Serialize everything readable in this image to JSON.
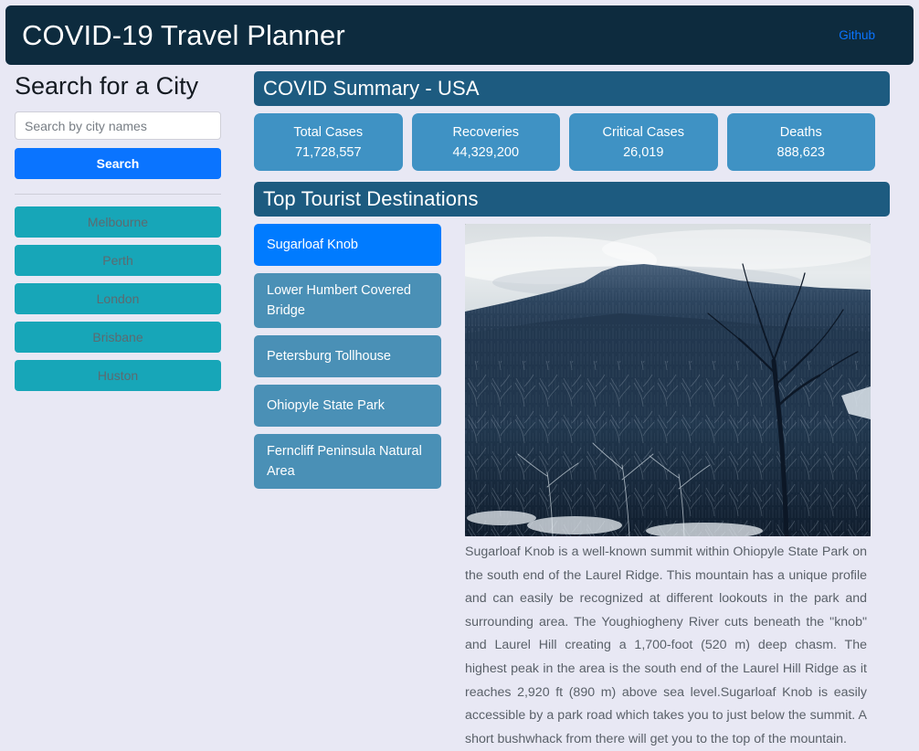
{
  "navbar": {
    "brand": "COVID-19 Travel Planner",
    "link_label": "Github",
    "background_color": "#0d2b3e",
    "link_color": "#0a74ff"
  },
  "sidebar": {
    "title": "Search for a City",
    "search": {
      "placeholder": "Search by city names",
      "value": "",
      "button_label": "Search",
      "button_color": "#0a74ff"
    },
    "cities": [
      {
        "label": "Melbourne"
      },
      {
        "label": "Perth"
      },
      {
        "label": "London"
      },
      {
        "label": "Brisbane"
      },
      {
        "label": "Huston"
      }
    ],
    "city_button_color": "#17a6b8"
  },
  "summary": {
    "header": "COVID Summary - USA",
    "header_color": "#1d5b80",
    "card_color": "#3f92c4",
    "stats": [
      {
        "label": "Total Cases",
        "value": "71,728,557"
      },
      {
        "label": "Recoveries",
        "value": "44,329,200"
      },
      {
        "label": "Critical Cases",
        "value": "26,019"
      },
      {
        "label": "Deaths",
        "value": "888,623"
      }
    ]
  },
  "destinations": {
    "header": "Top Tourist Destinations",
    "header_color": "#1d5b80",
    "item_color": "#4a90b6",
    "active_color": "#007bff",
    "items": [
      {
        "label": "Sugarloaf Knob",
        "active": true
      },
      {
        "label": "Lower Humbert Covered Bridge",
        "active": false
      },
      {
        "label": "Petersburg Tollhouse",
        "active": false
      },
      {
        "label": "Ohiopyle State Park",
        "active": false
      },
      {
        "label": "Ferncliff Peninsula Natural Area",
        "active": false
      }
    ],
    "detail": {
      "photo_alt": "Snow-covered forested ridge with Sugarloaf Knob summit under an overcast winter sky",
      "description": "Sugarloaf Knob is a well-known summit within Ohiopyle State Park on the south end of the Laurel Ridge. This mountain has a unique profile and can easily be recognized at different lookouts in the park and surrounding area. The Youghiogheny River cuts beneath the \"knob\" and Laurel Hill creating a 1,700-foot (520 m) deep chasm. The highest peak in the area is the south end of the Laurel Hill Ridge as it reaches 2,920 ft (890 m) above sea level.Sugarloaf Knob is easily accessible by a park road which takes you to just below the summit. A short bushwhack from there will get you to the top of the mountain."
    }
  }
}
